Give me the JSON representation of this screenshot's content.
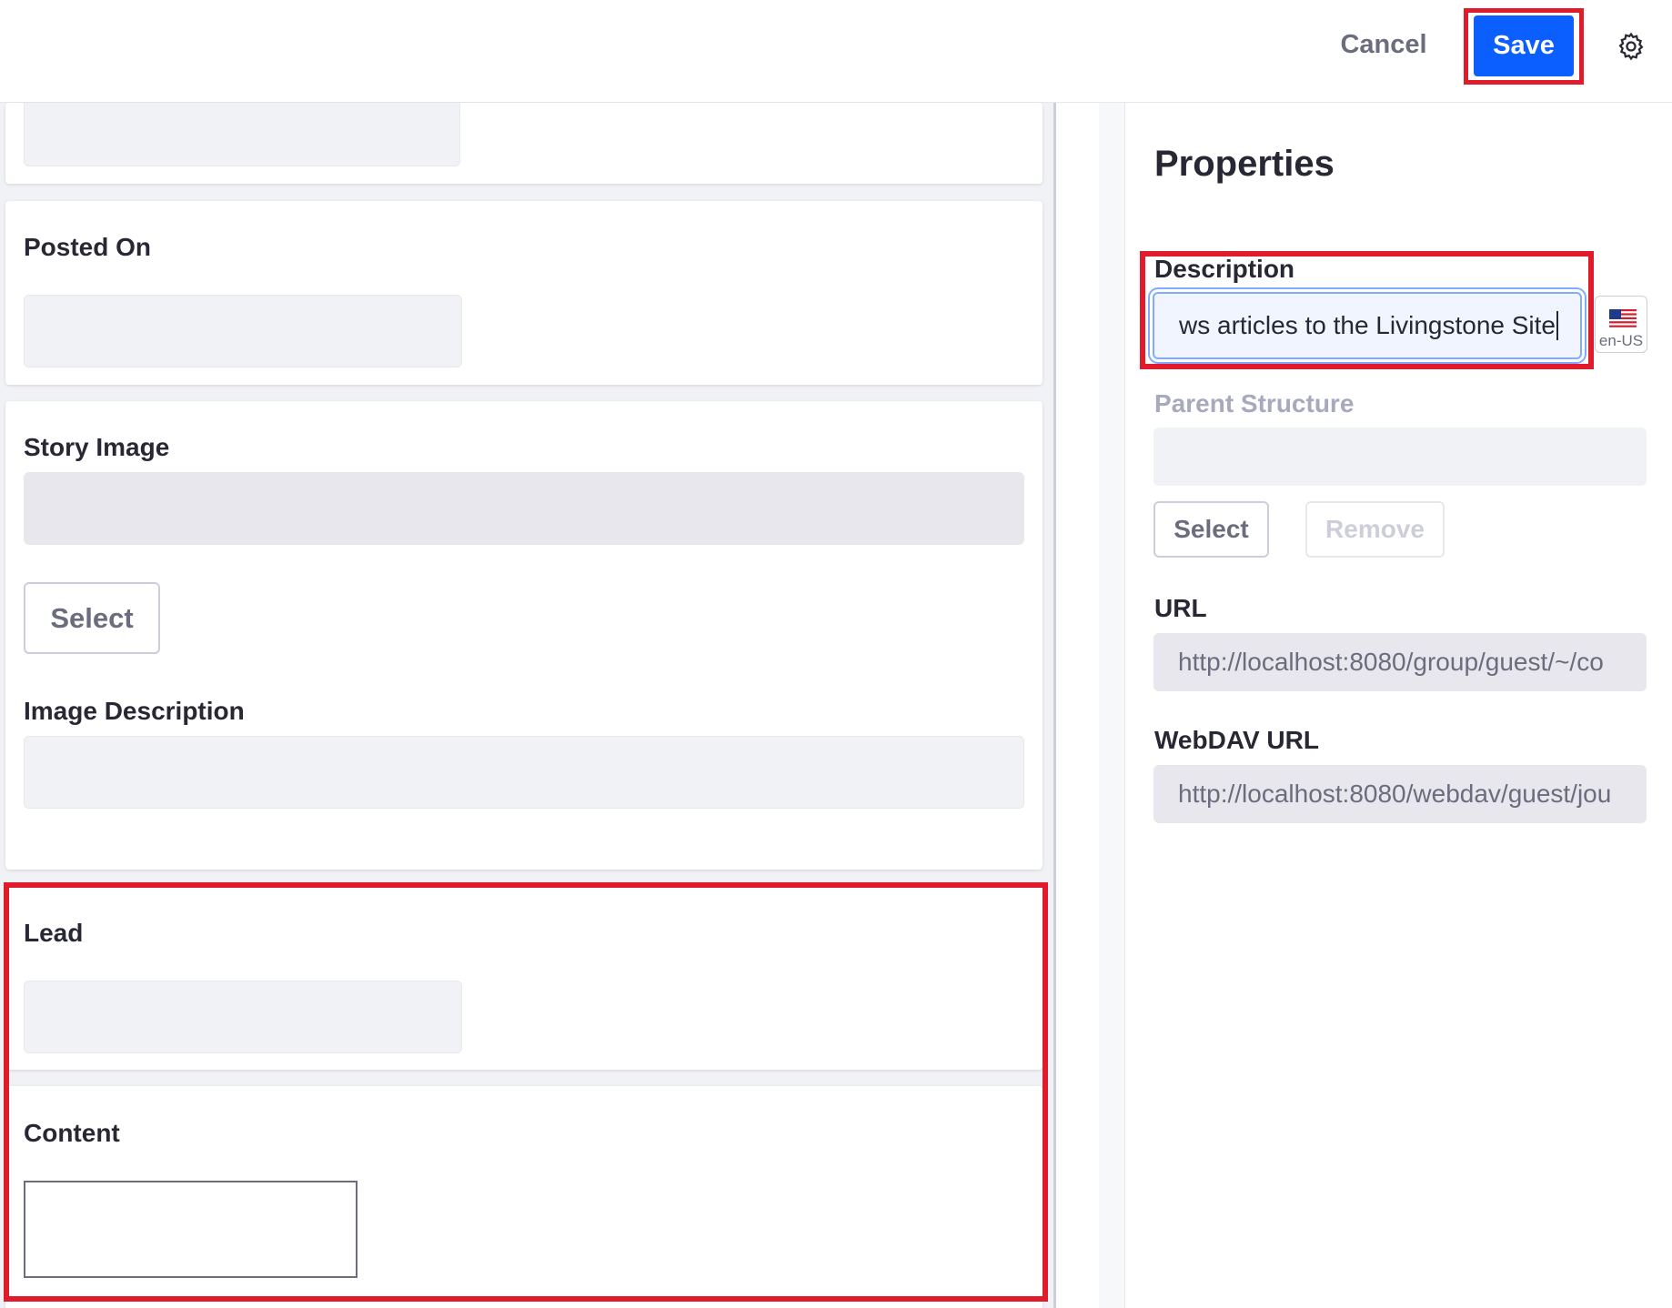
{
  "toolbar": {
    "cancel_label": "Cancel",
    "save_label": "Save",
    "settings_icon": "gear-icon"
  },
  "form": {
    "posted_on_label": "Posted On",
    "story_image_label": "Story Image",
    "story_image_select_label": "Select",
    "image_description_label": "Image Description",
    "lead_label": "Lead",
    "content_label": "Content"
  },
  "properties": {
    "title": "Properties",
    "description_label": "Description",
    "description_value": "ws articles to the Livingstone Site",
    "language_code": "en-US",
    "language_flag_icon": "us-flag-icon",
    "parent_structure_label": "Parent Structure",
    "select_label": "Select",
    "remove_label": "Remove",
    "url_label": "URL",
    "url_value": "http://localhost:8080/group/guest/~/co",
    "webdav_url_label": "WebDAV URL",
    "webdav_url_value": "http://localhost:8080/webdav/guest/jou"
  },
  "colors": {
    "primary": "#0b5fff",
    "highlight": "#e01b2b"
  }
}
